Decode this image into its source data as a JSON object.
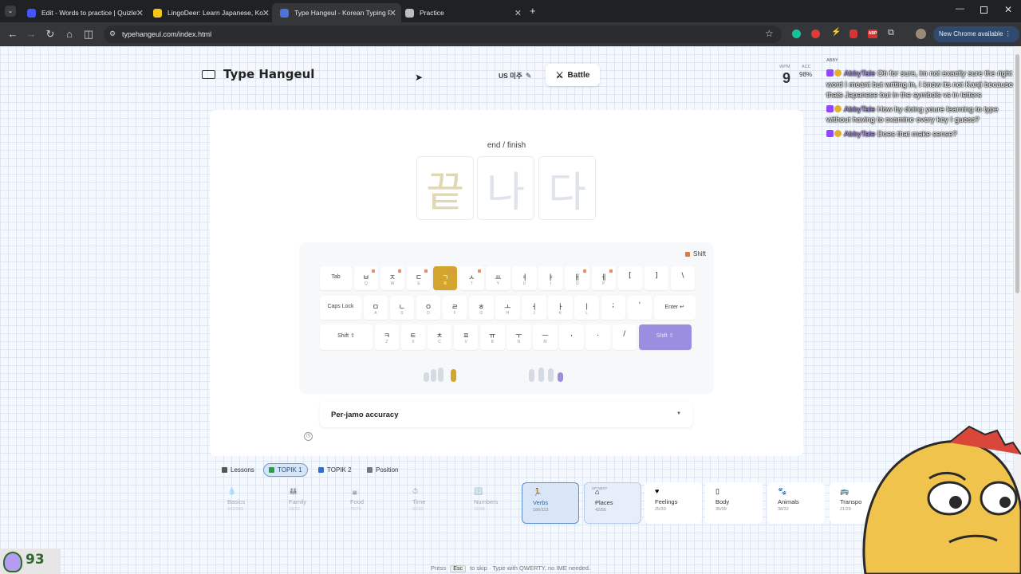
{
  "browser": {
    "tabs": [
      {
        "title": "Edit - Words to practice | Quizlet",
        "fav_color": "#4255ff"
      },
      {
        "title": "LingoDeer: Learn Japanese, Korean",
        "fav_color": "#f5c518"
      },
      {
        "title": "Type Hangeul - Korean Typing Practice",
        "fav_color": "#4e73df"
      },
      {
        "title": "Practice",
        "fav_color": "#bdbdbd"
      }
    ],
    "url": "typehangeul.com/index.html",
    "new_chrome_label": "New Chrome available"
  },
  "header": {
    "brand": "Type Hangeul",
    "layout_label": "US 미주",
    "battle_label": "Battle",
    "wpm_label": "WPM",
    "wpm_value": "9",
    "acc_label": "ACC",
    "acc_value": "98%"
  },
  "practice": {
    "word_meaning": "end / finish",
    "syllables": [
      "끝",
      "나",
      "다"
    ],
    "current_index": 0
  },
  "keyboard": {
    "shift_legend": "Shift",
    "row1": [
      {
        "label": "Tab",
        "wide": true
      },
      {
        "jamo": "ㅂ",
        "sub": "Q",
        "shift": true
      },
      {
        "jamo": "ㅈ",
        "sub": "W",
        "shift": true
      },
      {
        "jamo": "ㄷ",
        "sub": "E",
        "shift": true
      },
      {
        "jamo": "ㄱ",
        "sub": "R",
        "shift": true,
        "highlight": true
      },
      {
        "jamo": "ㅅ",
        "sub": "T",
        "shift": true
      },
      {
        "jamo": "ㅛ",
        "sub": "Y"
      },
      {
        "jamo": "ㅕ",
        "sub": "U"
      },
      {
        "jamo": "ㅑ",
        "sub": "I"
      },
      {
        "jamo": "ㅐ",
        "sub": "O",
        "shift": true
      },
      {
        "jamo": "ㅔ",
        "sub": "P",
        "shift": true
      },
      {
        "jamo": "[",
        "sub": ""
      },
      {
        "jamo": "]",
        "sub": ""
      },
      {
        "jamo": "\\",
        "sub": ""
      }
    ],
    "row2": [
      {
        "label": "Caps Lock",
        "wide": true
      },
      {
        "jamo": "ㅁ",
        "sub": "A"
      },
      {
        "jamo": "ㄴ",
        "sub": "S"
      },
      {
        "jamo": "ㅇ",
        "sub": "D"
      },
      {
        "jamo": "ㄹ",
        "sub": "F"
      },
      {
        "jamo": "ㅎ",
        "sub": "G"
      },
      {
        "jamo": "ㅗ",
        "sub": "H"
      },
      {
        "jamo": "ㅓ",
        "sub": "J"
      },
      {
        "jamo": "ㅏ",
        "sub": "K"
      },
      {
        "jamo": "ㅣ",
        "sub": "L"
      },
      {
        "jamo": ";",
        "sub": ""
      },
      {
        "jamo": "'",
        "sub": ""
      },
      {
        "label": "Enter ↵",
        "wide": true
      }
    ],
    "row3": [
      {
        "label": "Shift ⇧",
        "wide": true
      },
      {
        "jamo": "ㅋ",
        "sub": "Z"
      },
      {
        "jamo": "ㅌ",
        "sub": "X"
      },
      {
        "jamo": "ㅊ",
        "sub": "C"
      },
      {
        "jamo": "ㅍ",
        "sub": "V"
      },
      {
        "jamo": "ㅠ",
        "sub": "B"
      },
      {
        "jamo": "ㅜ",
        "sub": "N"
      },
      {
        "jamo": "ㅡ",
        "sub": "M"
      },
      {
        "jamo": ",",
        "sub": ""
      },
      {
        "jamo": ".",
        "sub": ""
      },
      {
        "jamo": "/",
        "sub": ""
      },
      {
        "label": "Shift ⇧",
        "wide": true,
        "shift_active": true
      }
    ],
    "finger_colors": {
      "left_active": "#d4a52d",
      "right_active": "#9b8ee0"
    }
  },
  "accuracy": {
    "title": "Per-jamo accuracy"
  },
  "lessons": {
    "tabs": [
      {
        "label": "Lessons",
        "icon_color": "#555"
      },
      {
        "label": "TOPIK 1",
        "icon_color": "#2e9c4d",
        "active": true
      },
      {
        "label": "TOPIK 2",
        "icon_color": "#2e6fd0"
      },
      {
        "label": "Position",
        "icon_color": "#777"
      }
    ],
    "categories": [
      {
        "name": "Basics",
        "count": "342/343",
        "state": "done",
        "icon": "💧"
      },
      {
        "name": "Family",
        "count": "23/22",
        "state": "done",
        "icon": "👪"
      },
      {
        "name": "Food",
        "count": "76/76",
        "state": "done",
        "icon": "🍙"
      },
      {
        "name": "Time",
        "count": "32/32",
        "state": "done",
        "icon": "⏱"
      },
      {
        "name": "Numbers",
        "count": "21/25",
        "state": "done",
        "icon": "🔢"
      },
      {
        "name": "Verbs",
        "count": "186/113",
        "state": "active",
        "icon": "🏃"
      },
      {
        "name": "Places",
        "count": "42/55",
        "state": "next",
        "icon": "⌂",
        "upnext": "UP NEXT"
      },
      {
        "name": "Feelings",
        "count": "25/33",
        "state": "norm",
        "icon": "♥"
      },
      {
        "name": "Body",
        "count": "35/39",
        "state": "norm",
        "icon": "▯"
      },
      {
        "name": "Animals",
        "count": "38/32",
        "state": "norm",
        "icon": "🐾"
      },
      {
        "name": "Transpo",
        "count": "21/29",
        "state": "norm",
        "icon": "🚌"
      }
    ]
  },
  "footer": {
    "press": "Press",
    "esc": "Esc",
    "hint": "to skip · Type with QWERTY, no IME needed."
  },
  "chat": {
    "header": "ABBY",
    "messages": [
      {
        "user": "AbbyTale",
        "text": "Oh for sure, im not exactly sure the right word I meant but writing in, I know its not Kanji because thats Japanese but in the symbols vs in letters"
      },
      {
        "user": "AbbyTale",
        "text": "How by doing youre learning to type without having to examine every key I guess?"
      },
      {
        "user": "AbbyTale",
        "text": "Does that make sense?"
      }
    ]
  },
  "overlay": {
    "score": "93"
  }
}
